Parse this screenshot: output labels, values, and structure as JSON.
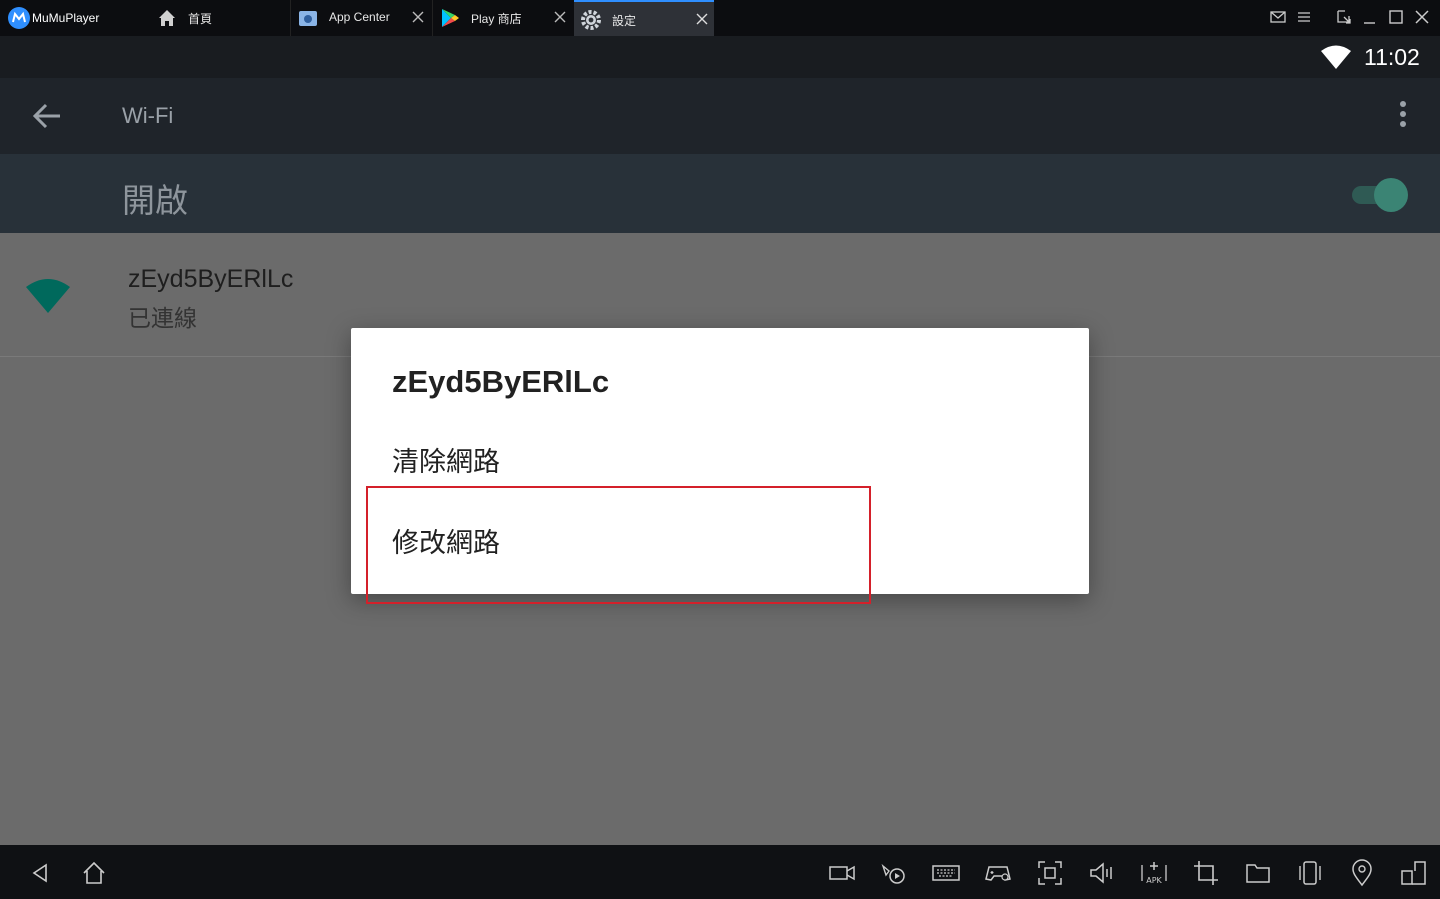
{
  "titlebar": {
    "brand": "MuMuPlayer",
    "tabs": [
      {
        "label": "首頁",
        "icon": "home-icon"
      },
      {
        "label": "App Center",
        "icon": "app-center-icon"
      },
      {
        "label": "Play 商店",
        "icon": "play-store-icon"
      },
      {
        "label": "設定",
        "icon": "settings-gear-icon",
        "active": true
      }
    ]
  },
  "statusbar": {
    "time": "11:02"
  },
  "appbar": {
    "title": "Wi-Fi"
  },
  "master_switch": {
    "label": "開啟",
    "on": true
  },
  "network": {
    "ssid": "zEyd5ByERlLc",
    "status": "已連線"
  },
  "dialog": {
    "title": "zEyd5ByERlLc",
    "items": [
      "清除網路",
      "修改網路"
    ]
  },
  "colors": {
    "accent_blue": "#2f8fff",
    "wifi_teal": "#00695c",
    "highlight_red": "#d4202a"
  }
}
